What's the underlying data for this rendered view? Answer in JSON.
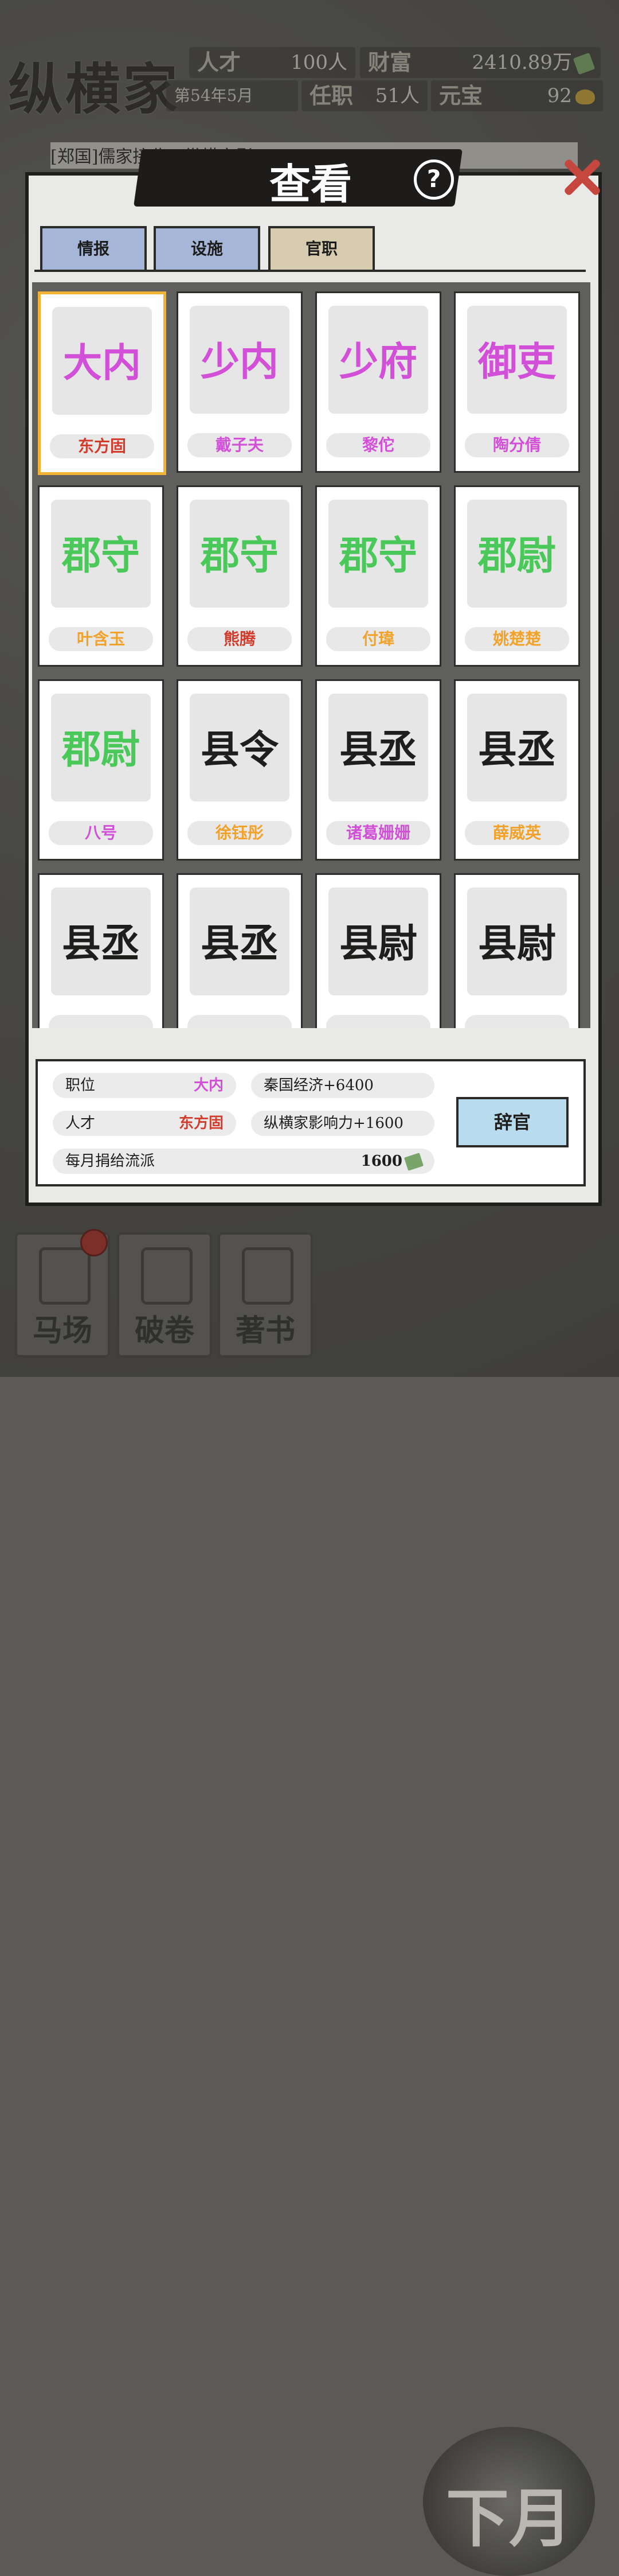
{
  "hud": {
    "app_title": "纵横家",
    "talent_label": "人才",
    "talent_value": "100人",
    "wealth_label": "财富",
    "wealth_value": "2410.89万",
    "date": "第54年5月",
    "office_label": "任职",
    "office_value": "51人",
    "yuanbao_label": "元宝",
    "yuanbao_value": "92",
    "news": "[郑国]儒家接收…纵横家影"
  },
  "modal": {
    "title": "查看",
    "tabs": [
      {
        "label": "情报",
        "color": "#a6b6d8"
      },
      {
        "label": "设施",
        "color": "#a6b6d8"
      },
      {
        "label": "官职",
        "color": "#d8ccb0",
        "active": true
      }
    ],
    "cards": [
      {
        "title": "大内",
        "name": "东方固",
        "title_color": "#d24fd8",
        "name_color": "#d23c2c",
        "selected": true
      },
      {
        "title": "少内",
        "name": "戴子夫",
        "title_color": "#d24fd8",
        "name_color": "#d24fd8"
      },
      {
        "title": "少府",
        "name": "黎佗",
        "title_color": "#d24fd8",
        "name_color": "#d24fd8"
      },
      {
        "title": "御吏",
        "name": "陶分倩",
        "title_color": "#d24fd8",
        "name_color": "#d24fd8"
      },
      {
        "title": "郡守",
        "name": "叶含玉",
        "title_color": "#4bc85a",
        "name_color": "#f0a22a"
      },
      {
        "title": "郡守",
        "name": "熊腾",
        "title_color": "#4bc85a",
        "name_color": "#d23c2c"
      },
      {
        "title": "郡守",
        "name": "付瑋",
        "title_color": "#4bc85a",
        "name_color": "#f0a22a"
      },
      {
        "title": "郡尉",
        "name": "姚楚楚",
        "title_color": "#4bc85a",
        "name_color": "#f0a22a"
      },
      {
        "title": "郡尉",
        "name": "八号",
        "title_color": "#4bc85a",
        "name_color": "#d24fd8"
      },
      {
        "title": "县令",
        "name": "徐钰彤",
        "title_color": "#1e1e1d",
        "name_color": "#f0a22a"
      },
      {
        "title": "县丞",
        "name": "诸葛姗姗",
        "title_color": "#1e1e1d",
        "name_color": "#d24fd8"
      },
      {
        "title": "县丞",
        "name": "薛威英",
        "title_color": "#1e1e1d",
        "name_color": "#f0a22a"
      },
      {
        "title": "县丞",
        "name": "",
        "title_color": "#1e1e1d",
        "name_color": "#d23c2c"
      },
      {
        "title": "县丞",
        "name": "",
        "title_color": "#1e1e1d",
        "name_color": "#d24fd8"
      },
      {
        "title": "县尉",
        "name": "",
        "title_color": "#1e1e1d",
        "name_color": "#f0a22a"
      },
      {
        "title": "县尉",
        "name": "",
        "title_color": "#1e1e1d",
        "name_color": "#d23c2c"
      }
    ],
    "info": {
      "position_label": "职位",
      "position_value": "大内",
      "talent_label": "人才",
      "talent_value": "东方固",
      "effect1": "秦国经济+6400",
      "effect2": "纵横家影响力+1600",
      "donation_label": "每月捐给流派",
      "donation_value": "1600",
      "resign_label": "辞官"
    }
  },
  "nav": {
    "stable": "马场",
    "scroll": "破卷",
    "write": "著书",
    "next_month": "下月"
  }
}
